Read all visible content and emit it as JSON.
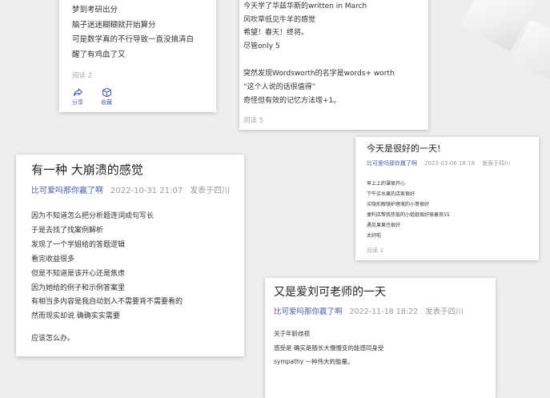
{
  "card1": {
    "lines": [
      "梦到考研出分",
      "脑子迷迷糊糊就开始算分",
      "可是数学真的不行导致一直没搞清白",
      "醒了有鸡血了又"
    ],
    "reads": "阅读 2",
    "actions": {
      "share_label": "分享",
      "collect_label": "收藏"
    },
    "accent_color": "#4a5fae"
  },
  "card2": {
    "lines_top": [
      "今天学了华兹华斯的written in March",
      "风吹草低见牛羊的感觉",
      "希望！春天！终将。",
      "尽管only 5"
    ],
    "words_line": {
      "before": "突然发现Wordsworth的名字是words",
      "plus": "+",
      "after": " worth"
    },
    "lines_bottom": [
      "“这个人说的话很值得”",
      "奇怪但有效的记忆方法增+1。"
    ],
    "reads": "阅读 5"
  },
  "card3": {
    "title": "有一种 大崩溃的感觉",
    "author": "比可爱吗那你赢了啊",
    "date": "2022-10-31 21:07",
    "place": "发表于四川",
    "lines": [
      "因为不知道怎么把分析题连词成句写长",
      "于是去找了找案例解析",
      "发现了一个学姐给的答题逻辑",
      "看完收益很多",
      "但是不知道是该开心还是焦虑",
      "因为她给的例子和示例答案里",
      "有相当多内容是我自动划入不需要背不需要看的",
      "然而现实却说 确确实实需要"
    ],
    "last_line": "应该怎么办。"
  },
  "card4": {
    "title": "今天是很好的一天!",
    "author": "比可爱吗那你赢了啊",
    "date": "2023-03-06 18:18",
    "place": "发表于四川",
    "lines": [
      "早上上的课很开心",
      "下午买水果的店家很好",
      "买隐形眼镜护理液的小哥很好",
      "便利店帮我热饭的小姐姐很好很善良55",
      "遇见果果也很好",
      "太好啦"
    ],
    "reads": "阅读 3"
  },
  "card5": {
    "title": "又是爱刘可老师的一天",
    "author": "比可爱吗那你赢了啊",
    "date": "2022-11-18 18:22",
    "place": "发表于四川",
    "lines": [
      "关于年龄歧视",
      "感受是 确实是随长大慢慢变的能感同身受",
      "sympathy 一种伟大的能量。"
    ]
  }
}
